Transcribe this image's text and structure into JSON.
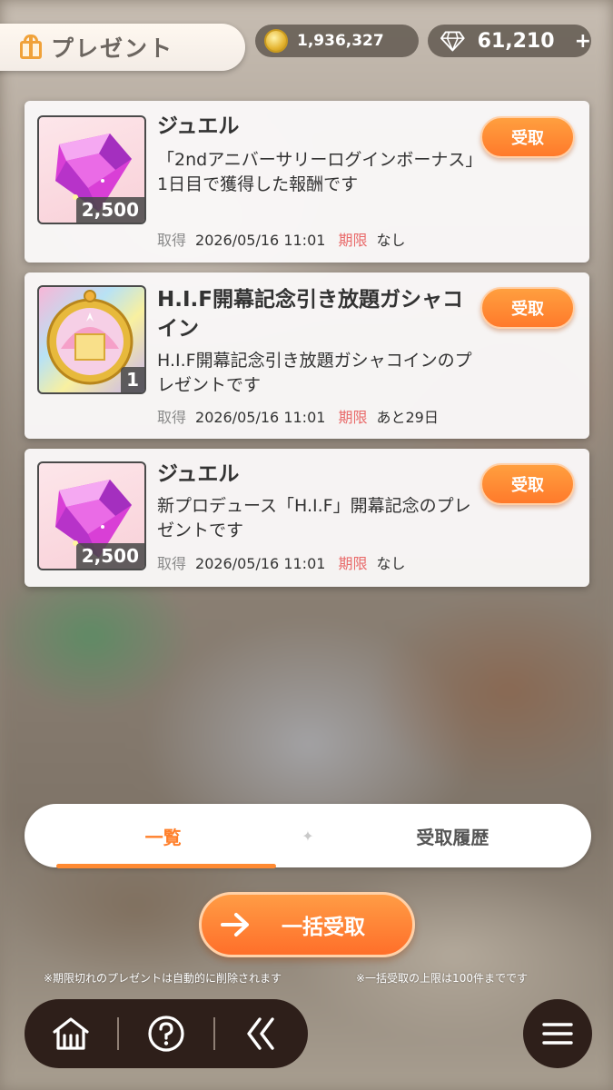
{
  "header": {
    "title": "プレゼント",
    "coins": "1,936,327",
    "jewels": "61,210",
    "jewels_add": "+"
  },
  "presents": [
    {
      "name": "ジュエル",
      "description": "「2ndアニバーサリーログインボーナス」1日目で獲得した報酬です",
      "quantity": "2,500",
      "acquired_label": "取得",
      "acquired_date": "2026/05/16 11:01",
      "expiry_label": "期限",
      "expiry_value": "なし",
      "receive_label": "受取",
      "icon": "jewel-icon"
    },
    {
      "name": "H.I.F開幕記念引き放題ガシャコイン",
      "description": "H.I.F開幕記念引き放題ガシャコインのプレゼントです",
      "quantity": "1",
      "acquired_label": "取得",
      "acquired_date": "2026/05/16 11:01",
      "expiry_label": "期限",
      "expiry_value": "あと29日",
      "receive_label": "受取",
      "icon": "gacha-coin-icon"
    },
    {
      "name": "ジュエル",
      "description": "新プロデュース「H.I.F」開幕記念のプレゼントです",
      "quantity": "2,500",
      "acquired_label": "取得",
      "acquired_date": "2026/05/16 11:01",
      "expiry_label": "期限",
      "expiry_value": "なし",
      "receive_label": "受取",
      "icon": "jewel-icon"
    }
  ],
  "tabs": {
    "list": "一覧",
    "history": "受取履歴"
  },
  "bulk_receive_label": "一括受取",
  "notes": {
    "left": "※期限切れのプレゼントは自動的に削除されます",
    "right": "※一括受取の上限は100件までです"
  },
  "colors": {
    "accent": "#ff7f2a",
    "expiry": "#e96a6a",
    "nav": "#2e1f1a"
  }
}
